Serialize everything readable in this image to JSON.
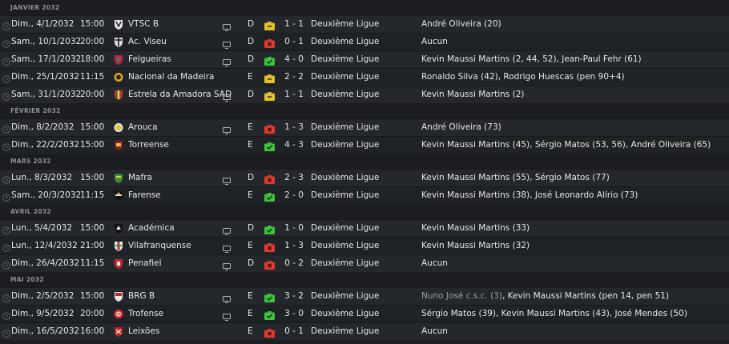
{
  "colors": {
    "win": "#3ec43e",
    "draw": "#e2c12a",
    "loss": "#e03b2e"
  },
  "months": [
    {
      "name": "JANVIER 2032",
      "matches": [
        {
          "date": "Dim., 4/1/2032",
          "time": "15:00",
          "crest": "vtsc",
          "opponent": "VTSC B",
          "tv": true,
          "venue": "D",
          "result": "draw",
          "score": "1 - 1",
          "competition": "Deuxième Ligue",
          "scorers": "André Oliveira (20)"
        },
        {
          "date": "Sam., 10/1/2032",
          "time": "20:00",
          "crest": "viseu",
          "opponent": "Ac. Viseu",
          "tv": true,
          "venue": "D",
          "result": "loss",
          "score": "0 - 1",
          "competition": "Deuxième Ligue",
          "scorers": "Aucun"
        },
        {
          "date": "Sam., 17/1/2032",
          "time": "18:00",
          "crest": "felgueiras",
          "opponent": "Felgueiras",
          "tv": true,
          "venue": "D",
          "result": "win",
          "score": "4 - 0",
          "competition": "Deuxième Ligue",
          "scorers": "Kevin Maussi Martins (2, 44, 52), Jean-Paul Fehr (61)"
        },
        {
          "date": "Dim., 25/1/2032",
          "time": "11:15",
          "crest": "nacional",
          "opponent": "Nacional da Madeira",
          "tv": false,
          "venue": "E",
          "result": "draw",
          "score": "2 - 2",
          "competition": "Deuxième Ligue",
          "scorers": "Ronaldo Silva (42), Rodrigo Huescas (pen 90+4)"
        },
        {
          "date": "Sam., 31/1/2032",
          "time": "20:00",
          "crest": "estrela",
          "opponent": "Estrela da Amadora SAD",
          "tv": true,
          "venue": "D",
          "result": "draw",
          "score": "1 - 1",
          "competition": "Deuxième Ligue",
          "scorers": "Kevin Maussi Martins (2)"
        }
      ]
    },
    {
      "name": "FÉVRIER 2032",
      "matches": [
        {
          "date": "Dim., 8/2/2032",
          "time": "15:00",
          "crest": "arouca",
          "opponent": "Arouca",
          "tv": true,
          "venue": "E",
          "result": "loss",
          "score": "1 - 3",
          "competition": "Deuxième Ligue",
          "scorers": "André Oliveira (73)"
        },
        {
          "date": "Dim., 22/2/2032",
          "time": "15:00",
          "crest": "torreense",
          "opponent": "Torreense",
          "tv": false,
          "venue": "E",
          "result": "win",
          "score": "4 - 3",
          "competition": "Deuxième Ligue",
          "scorers": "Kevin Maussi Martins (45), Sérgio Matos (53, 56), André Oliveira (65)"
        }
      ]
    },
    {
      "name": "MARS 2032",
      "matches": [
        {
          "date": "Lun., 8/3/2032",
          "time": "15:00",
          "crest": "mafra",
          "opponent": "Mafra",
          "tv": true,
          "venue": "D",
          "result": "loss",
          "score": "2 - 3",
          "competition": "Deuxième Ligue",
          "scorers": "Kevin Maussi Martins (55), Sérgio Matos (77)"
        },
        {
          "date": "Sam., 20/3/2032",
          "time": "11:15",
          "crest": "farense",
          "opponent": "Farense",
          "tv": false,
          "venue": "E",
          "result": "win",
          "score": "2 - 0",
          "competition": "Deuxième Ligue",
          "scorers": "Kevin Maussi Martins (38), José Leonardo Alírio (73)"
        }
      ]
    },
    {
      "name": "AVRIL 2032",
      "matches": [
        {
          "date": "Lun., 5/4/2032",
          "time": "15:00",
          "crest": "academica",
          "opponent": "Académica",
          "tv": true,
          "venue": "D",
          "result": "win",
          "score": "1 - 0",
          "competition": "Deuxième Ligue",
          "scorers": "Kevin Maussi Martins (33)"
        },
        {
          "date": "Lun., 12/4/2032",
          "time": "21:00",
          "crest": "vila",
          "opponent": "Vilafranquense",
          "tv": true,
          "venue": "E",
          "result": "loss",
          "score": "1 - 3",
          "competition": "Deuxième Ligue",
          "scorers": "Kevin Maussi Martins (32)"
        },
        {
          "date": "Dim., 26/4/2032",
          "time": "11:15",
          "crest": "penafiel",
          "opponent": "Penafiel",
          "tv": true,
          "venue": "D",
          "result": "loss",
          "score": "0 - 2",
          "competition": "Deuxième Ligue",
          "scorers": "Aucun"
        }
      ]
    },
    {
      "name": "MAI 2032",
      "matches": [
        {
          "date": "Dim., 2/5/2032",
          "time": "15:00",
          "crest": "brg",
          "opponent": "BRG B",
          "tv": true,
          "venue": "E",
          "result": "win",
          "score": "3 - 2",
          "competition": "Deuxième Ligue",
          "og_scorer": "Nuno José c.s.c. (3)",
          "scorers": ", Kevin Maussi Martins (pen 14, pen 51)"
        },
        {
          "date": "Dim., 9/5/2032",
          "time": "20:00",
          "crest": "trofense",
          "opponent": "Trofense",
          "tv": true,
          "venue": "E",
          "result": "win",
          "score": "3 - 0",
          "competition": "Deuxième Ligue",
          "scorers": "Sérgio Matos (39), Kevin Maussi Martins (43), José Mendes (50)"
        },
        {
          "date": "Dim., 16/5/2032",
          "time": "16:00",
          "crest": "leixoes",
          "opponent": "Leixões",
          "tv": false,
          "venue": "E",
          "result": "loss",
          "score": "0 - 1",
          "competition": "Deuxième Ligue",
          "scorers": "Aucun"
        }
      ]
    }
  ]
}
